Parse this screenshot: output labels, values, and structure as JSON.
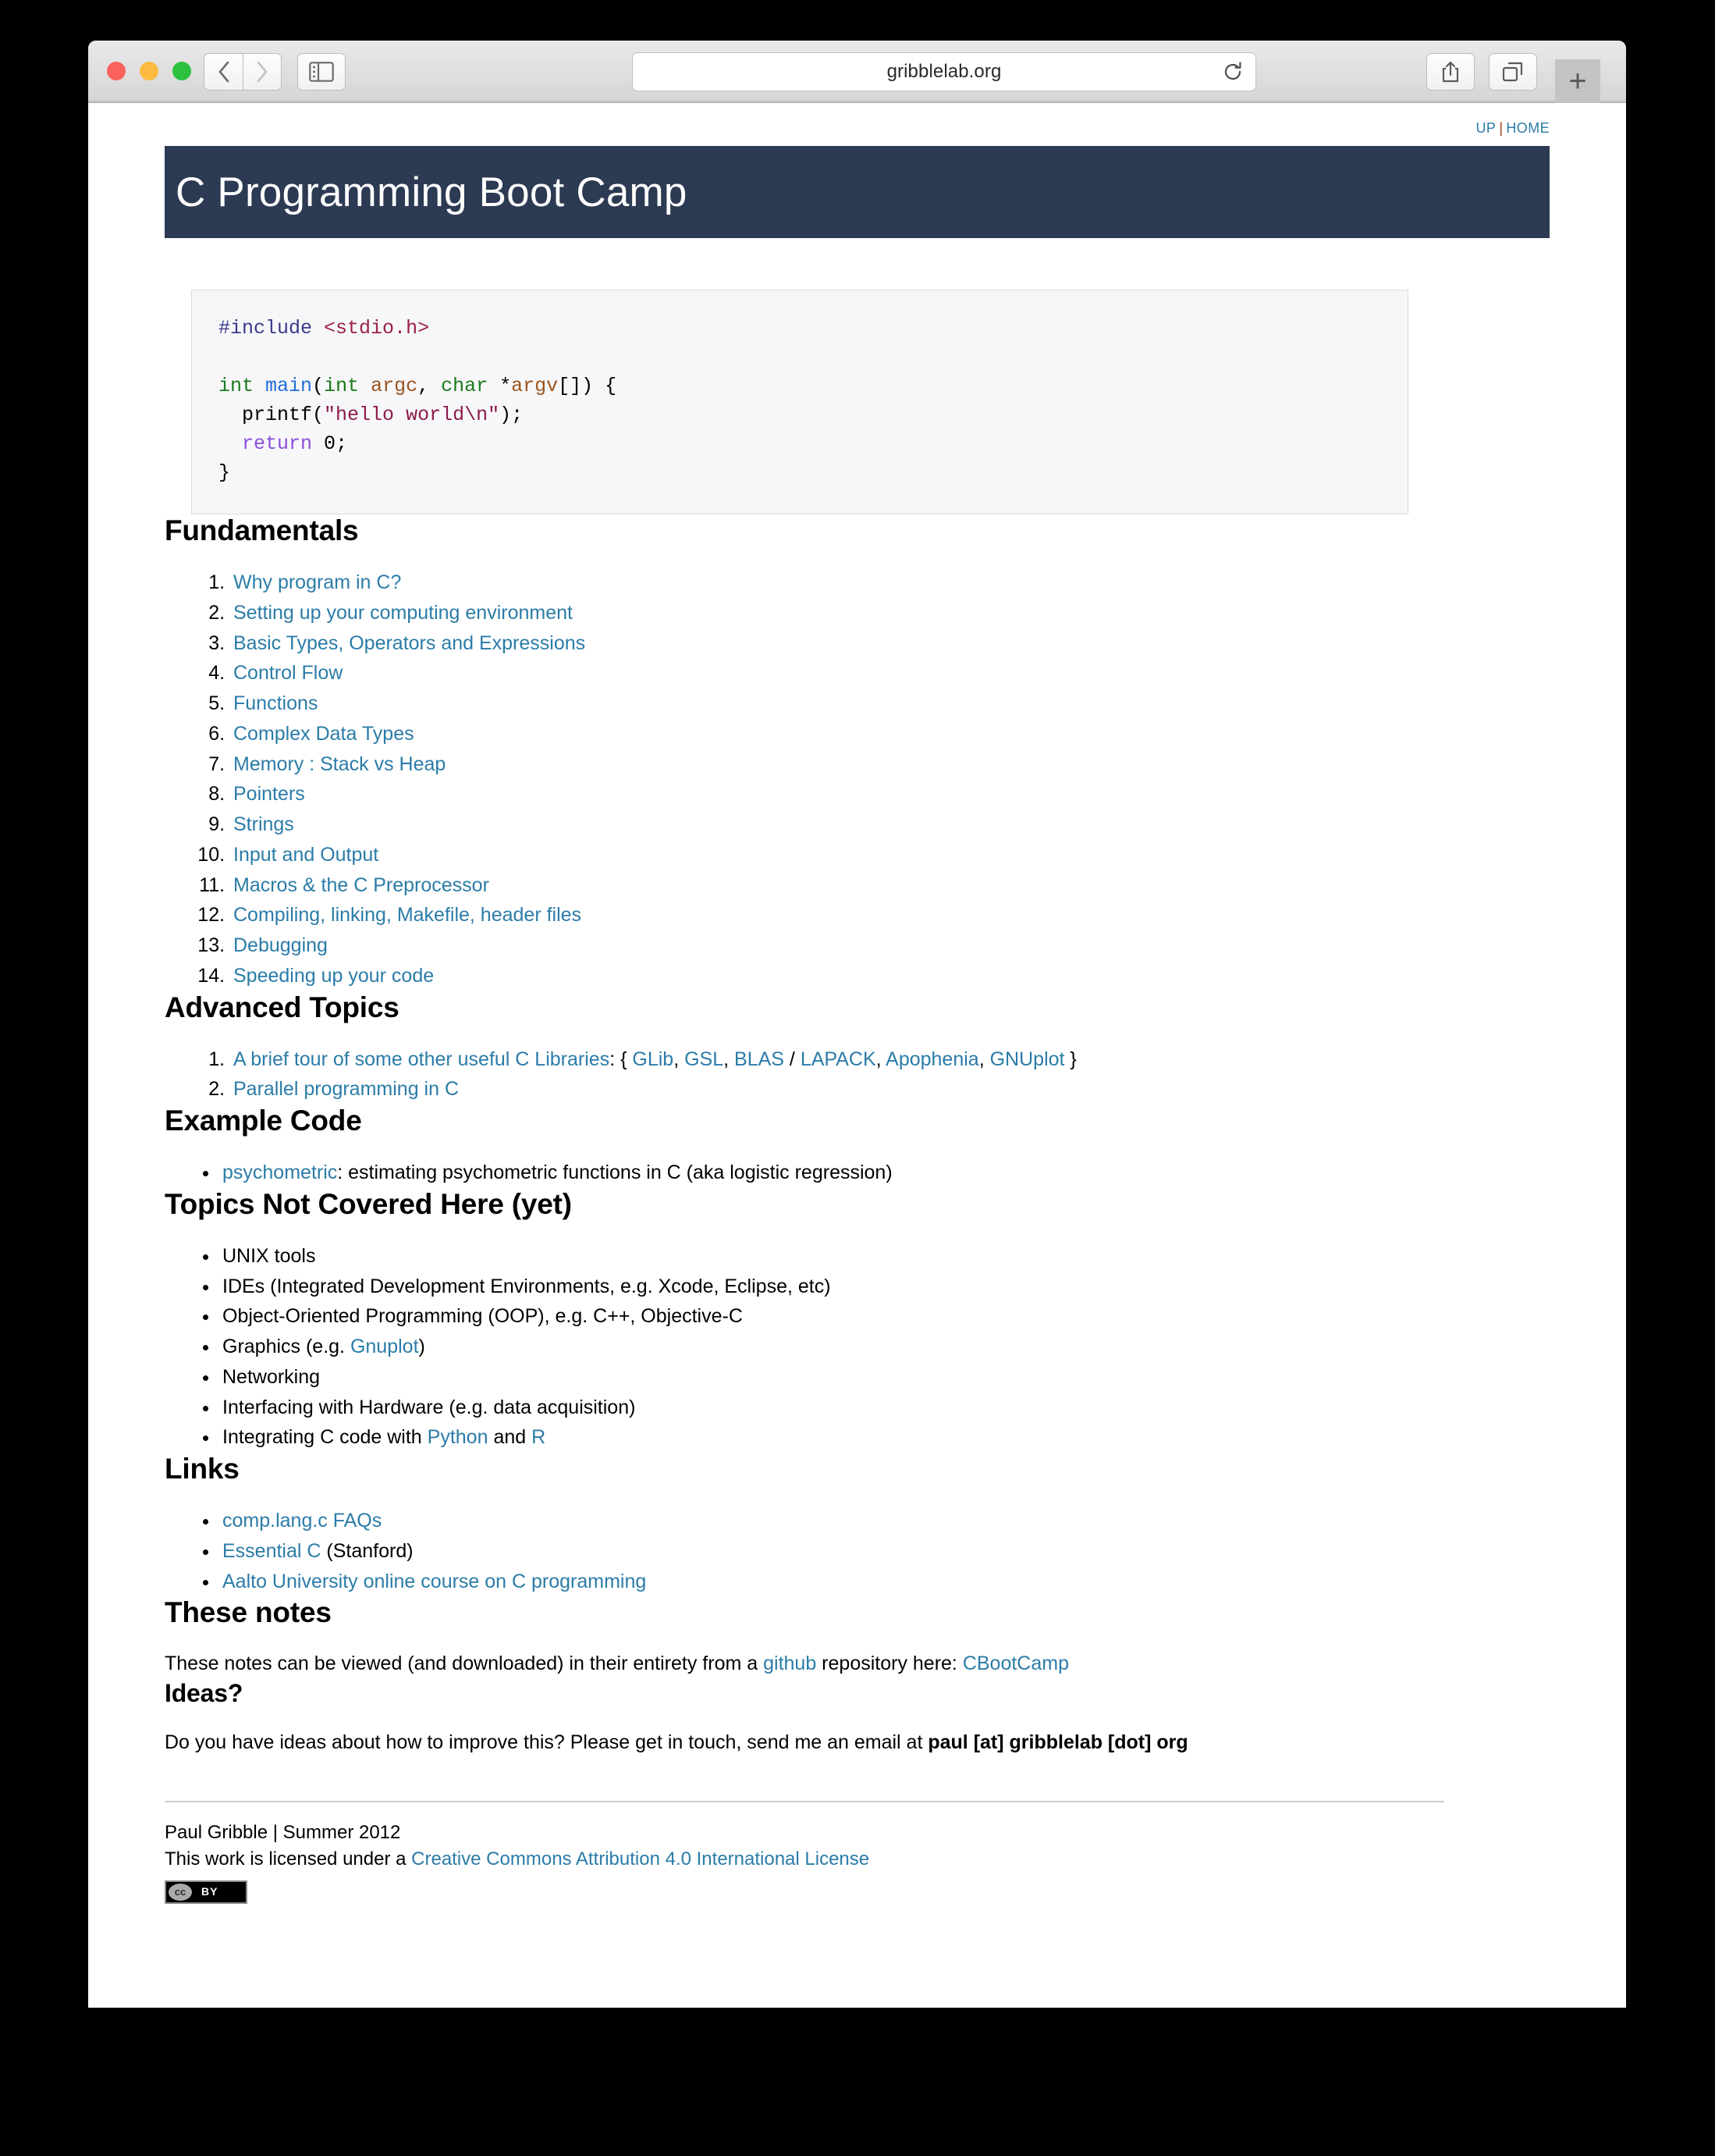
{
  "browser": {
    "url": "gribblelab.org",
    "buttons": {
      "back": "back-button",
      "forward": "forward-button",
      "sidebar": "sidebar-button",
      "reload": "reload-button",
      "share": "share-button",
      "tabs": "tabs-button",
      "newtab": "+"
    }
  },
  "topnav": {
    "up": "UP",
    "separator": "|",
    "home": "HOME"
  },
  "header": {
    "title": "C Programming Boot Camp",
    "bg_color": "#2c3a53"
  },
  "code_block": {
    "language": "c",
    "lines": [
      "#include <stdio.h>",
      "",
      "int main(int argc, char *argv[]) {",
      "  printf(\"hello world\\n\");",
      "  return 0;",
      "}"
    ],
    "tokens": {
      "preprocessor": "#include",
      "header": "<stdio.h>",
      "type_int": "int",
      "type_char": "char",
      "fn_main": "main",
      "var_argc": "argc",
      "var_argv": "argv",
      "fn_printf": "printf",
      "string": "\"hello world\\n\"",
      "kw_return": "return",
      "literal_zero": "0"
    }
  },
  "sections": {
    "fundamentals": {
      "heading": "Fundamentals",
      "items": [
        "Why program in C?",
        "Setting up your computing environment",
        "Basic Types, Operators and Expressions",
        "Control Flow",
        "Functions",
        "Complex Data Types",
        "Memory : Stack vs Heap",
        "Pointers",
        "Strings",
        "Input and Output",
        "Macros & the C Preprocessor",
        "Compiling, linking, Makefile, header files",
        "Debugging",
        "Speeding up your code"
      ]
    },
    "advanced": {
      "heading": "Advanced Topics",
      "item1_link": "A brief tour of some other useful C Libraries",
      "item1_colon": ": { ",
      "item1_libs": [
        "GLib",
        "GSL",
        "BLAS",
        "LAPACK",
        "Apophenia",
        "GNUplot"
      ],
      "item1_close": " }",
      "item2": "Parallel programming in C"
    },
    "example_code": {
      "heading": "Example Code",
      "link": "psychometric",
      "text": ": estimating psychometric functions in C (aka logistic regression)"
    },
    "not_covered": {
      "heading": "Topics Not Covered Here (yet)",
      "items": [
        "UNIX tools",
        "IDEs (Integrated Development Environments, e.g. Xcode, Eclipse, etc)",
        "Object-Oriented Programming (OOP), e.g. C++, Objective-C"
      ],
      "graphics_prefix": "Graphics (e.g. ",
      "graphics_link": "Gnuplot",
      "graphics_suffix": ")",
      "networking": "Networking",
      "hardware": "Interfacing with Hardware (e.g. data acquisition)",
      "integrating_prefix": "Integrating C code with ",
      "integrating_python": "Python",
      "integrating_and": " and ",
      "integrating_r": "R"
    },
    "links": {
      "heading": "Links",
      "item1": "comp.lang.c FAQs",
      "item2_link": "Essential C",
      "item2_suffix": " (Stanford)",
      "item3": "Aalto University online course on C programming"
    },
    "these_notes": {
      "heading": "These notes",
      "prefix": "These notes can be viewed (and downloaded) in their entirety from a ",
      "github_link": "github",
      "middle": " repository here: ",
      "repo_link": "CBootCamp"
    },
    "ideas": {
      "heading": "Ideas?",
      "prefix": "Do you have ideas about how to improve this? Please get in touch, send me an email at ",
      "email": "paul [at] gribblelab [dot] org"
    }
  },
  "footer": {
    "author_line": "Paul Gribble | Summer 2012",
    "license_prefix": "This work is licensed under a ",
    "license_link": "Creative Commons Attribution 4.0 International License",
    "badge_cc": "cc",
    "badge_by": "BY"
  },
  "colors": {
    "link": "#2b7ca8",
    "header_bg": "#2c3a53",
    "code_bg": "#f7f7f9"
  }
}
